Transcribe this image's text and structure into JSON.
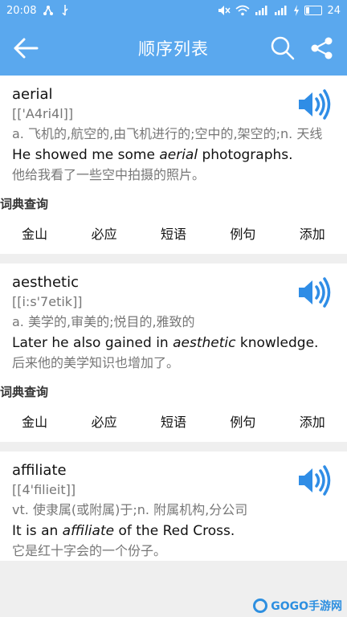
{
  "status_bar": {
    "time": "20:08",
    "battery_level": "24"
  },
  "app_bar": {
    "title": "顺序列表"
  },
  "cards": [
    {
      "word": "aerial",
      "phonetic": "[['A4ri4l]]",
      "meaning": "a. 飞机的,航空的,由飞机进行的;空中的,架空的;n. 天线",
      "sentence_before": "He showed me some ",
      "sentence_keyword": "aerial",
      "sentence_after": " photographs.",
      "sentence_cn": "他给我看了一些空中拍摄的照片。"
    },
    {
      "word": "aesthetic",
      "phonetic": "[[i:s'7etik]]",
      "meaning": "a. 美学的,审美的;悦目的,雅致的",
      "sentence_before": "Later he also gained in ",
      "sentence_keyword": "aesthetic",
      "sentence_after": " knowledge.",
      "sentence_cn": "后来他的美学知识也增加了。"
    },
    {
      "word": "affiliate",
      "phonetic": "[[4'filieit]]",
      "meaning": "vt. 使隶属(或附属)于;n. 附属机构,分公司",
      "sentence_before": "It is an ",
      "sentence_keyword": "affiliate",
      "sentence_after": " of the Red Cross.",
      "sentence_cn": "它是红十字会的一个份子。"
    }
  ],
  "dict_label": "词典查询",
  "actions": {
    "jinshan": "金山",
    "biying": "必应",
    "duanyu": "短语",
    "liju": "例句",
    "tianjia": "添加"
  },
  "watermark": {
    "text": "GOGO手游网"
  },
  "colors": {
    "header": "#5aa8ee",
    "speaker": "#2f8de6"
  }
}
